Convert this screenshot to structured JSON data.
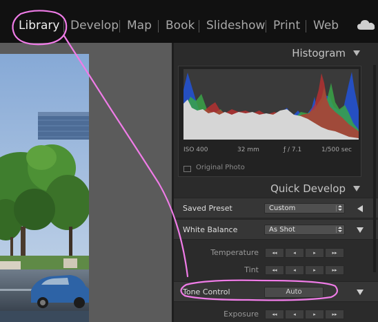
{
  "modules": {
    "items": [
      {
        "label": "Library",
        "active": true
      },
      {
        "label": "Develop",
        "active": false
      },
      {
        "label": "Map",
        "active": false
      },
      {
        "label": "Book",
        "active": false
      },
      {
        "label": "Slideshow",
        "active": false
      },
      {
        "label": "Print",
        "active": false
      },
      {
        "label": "Web",
        "active": false
      }
    ],
    "cloud_icon": "cloud-icon"
  },
  "histogram": {
    "title": "Histogram",
    "iso": "ISO 400",
    "focal": "32 mm",
    "aperture": "ƒ / 7.1",
    "shutter": "1/500 sec",
    "original_photo": "Original Photo"
  },
  "quick_develop": {
    "title": "Quick Develop",
    "saved_preset": {
      "label": "Saved Preset",
      "value": "Custom"
    },
    "white_balance": {
      "label": "White Balance",
      "value": "As Shot"
    },
    "temperature": {
      "label": "Temperature"
    },
    "tint": {
      "label": "Tint"
    },
    "tone_control": {
      "label": "Tone Control",
      "button": "Auto"
    },
    "exposure": {
      "label": "Exposure"
    },
    "step_glyphs": [
      "◂◂",
      "◂",
      "▸",
      "▸▸"
    ]
  },
  "colors": {
    "annotation": "#f07ce8",
    "active_module": "#f0f0f0",
    "panel_bg": "#2b2b2b"
  }
}
